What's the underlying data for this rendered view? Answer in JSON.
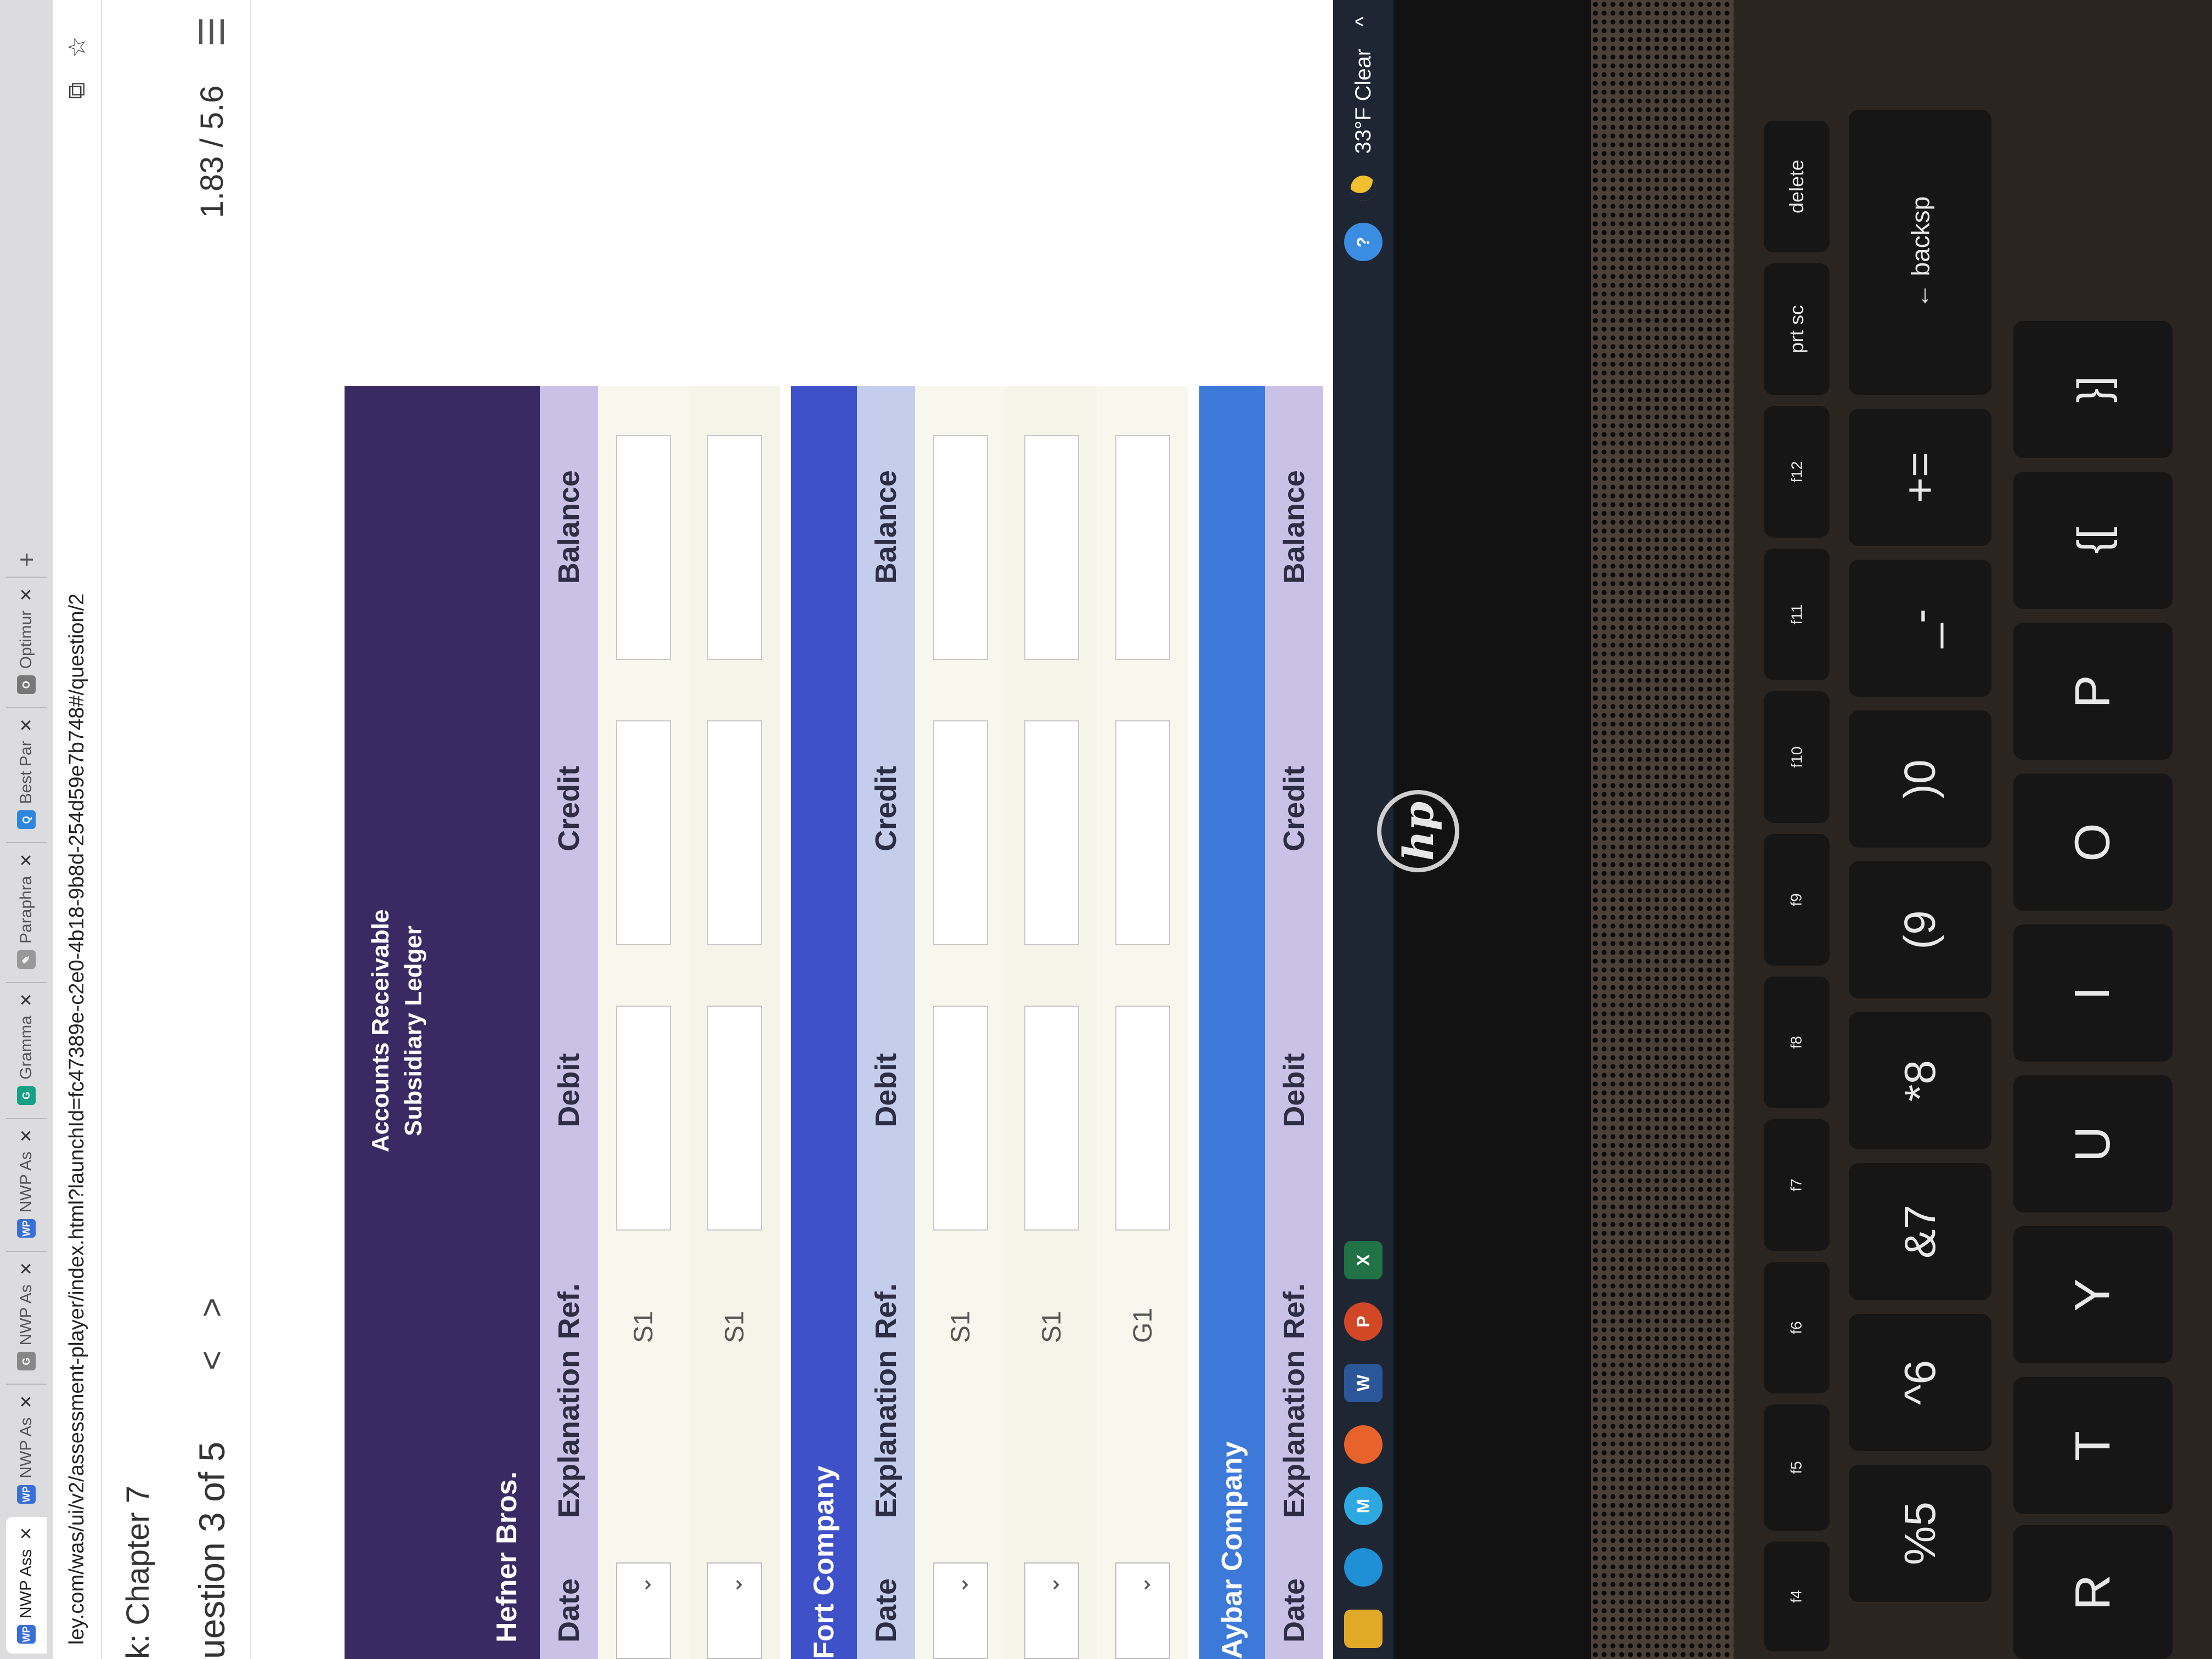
{
  "browser": {
    "tabs": [
      {
        "label": "NWP Ass",
        "fav": "WP",
        "color": "#3a6fd8"
      },
      {
        "label": "NWP As",
        "fav": "WP",
        "color": "#3a6fd8"
      },
      {
        "label": "NWP As",
        "fav": "G",
        "color": "#888"
      },
      {
        "label": "NWP As",
        "fav": "WP",
        "color": "#3a6fd8"
      },
      {
        "label": "Gramma",
        "fav": "G",
        "color": "#16a085"
      },
      {
        "label": "Paraphra",
        "fav": "✎",
        "color": "#999"
      },
      {
        "label": "Best Par",
        "fav": "Q",
        "color": "#2e86de"
      },
      {
        "label": "Optimur",
        "fav": "O",
        "color": "#777"
      }
    ],
    "url": "ley.com/was/ui/v2/assessment-player/index.html?launchId=fc47389e-c2e0-4b18-9b8d-254d59e7b748#/question/2"
  },
  "page": {
    "course": "k: Chapter 7",
    "question": "uestion 3 of 5",
    "prev": "<",
    "next": ">",
    "score": "1.83 / 5.6"
  },
  "ledger": {
    "title_line1": "Accounts Receivable",
    "title_line2": "Subsidiary Ledger",
    "columns": {
      "date": "Date",
      "explanation": "Explanation",
      "ref": "Ref.",
      "debit": "Debit",
      "credit": "Credit",
      "balance": "Balance"
    },
    "customers": [
      {
        "name": "Hefner Bros.",
        "refs": [
          "S1",
          "S1"
        ]
      },
      {
        "name": "Fort Company",
        "refs": [
          "S1",
          "S1",
          "G1"
        ]
      },
      {
        "name": "Aybar Company",
        "refs": []
      }
    ]
  },
  "taskbar": {
    "weather": "33°F Clear"
  },
  "keyboard": {
    "fkeys": [
      "f4",
      "f5",
      "f6",
      "f7",
      "f8",
      "f9",
      "f10",
      "f11",
      "f12",
      "prt sc",
      "delete"
    ],
    "numbers": [
      "%5",
      "^6",
      "&7",
      "*8",
      "(9",
      ")0",
      "_-",
      "+=",
      "← backsp"
    ],
    "letters": [
      "R",
      "T",
      "Y",
      "U",
      "I",
      "O",
      "P",
      "{[",
      "}]"
    ]
  }
}
